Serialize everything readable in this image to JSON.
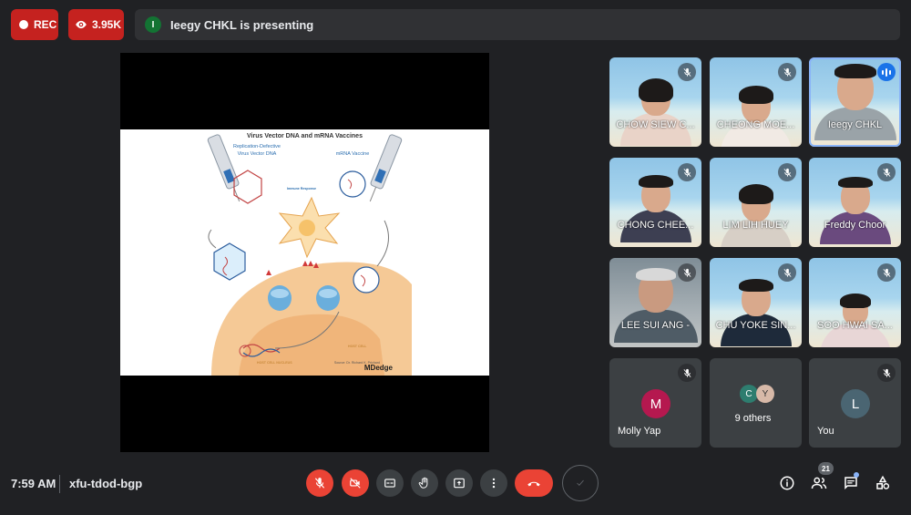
{
  "top": {
    "rec_label": "REC",
    "viewers_count": "3.95K",
    "presenter_initial": "I",
    "presenting_text": "Ieegy CHKL is presenting"
  },
  "slide": {
    "title": "Virus Vector DNA and mRNA Vaccines",
    "left_heading": "Replication-Defective",
    "left_heading_2": "Virus Vector DNA",
    "right_heading": "mRNA Vaccine",
    "immune_label": "Immune Response",
    "host_cell_label": "HOST CELL",
    "nucleus_label": "HOST CELL NUCLEUS",
    "credit": "Source: Dr. Richard K. Prichard",
    "logo": "MDedge"
  },
  "tiles": [
    {
      "name": "CHOW SIEW C...",
      "muted": true
    },
    {
      "name": "CHEONG MOE...",
      "muted": true
    },
    {
      "name": "Ieegy CHKL",
      "speaking": true
    },
    {
      "name": "CHONG CHEE...",
      "muted": true
    },
    {
      "name": "LIM LIH HUEY",
      "muted": true
    },
    {
      "name": "Freddy Choor",
      "muted": true
    },
    {
      "name": "LEE SUI ANG -",
      "muted": true
    },
    {
      "name": "CHU YOKE SIN...",
      "muted": true
    },
    {
      "name": "SOO HWAI SA...",
      "muted": true
    }
  ],
  "others": {
    "molly_initial": "M",
    "molly_name": "Molly Yap",
    "group_initials": [
      "C",
      "Y"
    ],
    "group_label": "9 others",
    "you_initial": "L",
    "you_label": "You"
  },
  "bottom": {
    "time": "7:59 AM",
    "meeting_code": "xfu-tdod-bgp",
    "people_count": "21"
  },
  "colors": {
    "accent_red": "#ea4335",
    "rec_red": "#c5221f",
    "speaking_blue": "#1a73e8",
    "molly_avatar": "#b5184f",
    "you_avatar": "#4a6572",
    "presenter_avatar": "#137333"
  },
  "icons": [
    "record-dot-icon",
    "eye-icon",
    "mic-off-icon",
    "camera-off-icon",
    "captions-icon",
    "raise-hand-icon",
    "present-icon",
    "more-icon",
    "end-call-icon",
    "info-icon",
    "people-icon",
    "chat-icon",
    "activities-icon"
  ]
}
